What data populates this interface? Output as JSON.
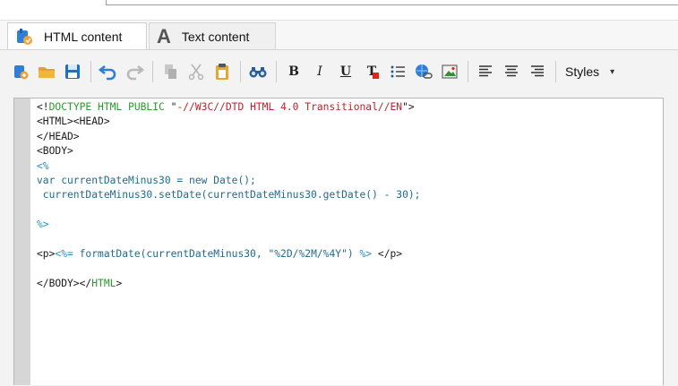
{
  "tabs": {
    "html_label": "HTML content",
    "text_label": "Text content",
    "text_icon_letter": "A"
  },
  "toolbar": {
    "icons": [
      "new-document-icon",
      "open-folder-icon",
      "save-icon",
      "undo-icon",
      "redo-icon",
      "copy-icon",
      "cut-icon",
      "paste-icon",
      "find-icon",
      "bold-icon",
      "italic-icon",
      "underline-icon",
      "text-color-icon",
      "list-icon",
      "insert-link-icon",
      "insert-image-icon",
      "align-left-icon",
      "align-center-icon",
      "align-right-icon"
    ],
    "bold_label": "B",
    "italic_label": "I",
    "underline_label": "U",
    "textcolor_label": "T",
    "styles_label": "Styles"
  },
  "code": {
    "l1a": "<!",
    "l1b": "DOCTYPE HTML PUBLIC",
    "l1c": " \"",
    "l1d": "-//W3C//DTD HTML 4.0 Transitional//EN",
    "l1e": "\">",
    "l2a": "<HTML><HEAD>",
    "l3": "</HEAD>",
    "l4": "<BODY>",
    "l5": "<%",
    "l6": "var currentDateMinus30 = new Date();",
    "l7": " currentDateMinus30.setDate(currentDateMinus30.getDate() - 30);",
    "l9": "%>",
    "l11a": "<p>",
    "l11b": "<%=",
    "l11c": " formatDate(currentDateMinus30, \"%2D/%2M/%4Y\") ",
    "l11d": "%>",
    "l11e": " </p>",
    "l13a": "</BODY></",
    "l13b": "HTML",
    "l13c": ">"
  },
  "colors": {
    "tag": "#1a1a1a",
    "doctype": "#2a9a2a",
    "string": "#c0202a",
    "script": "#1f6b8f"
  }
}
